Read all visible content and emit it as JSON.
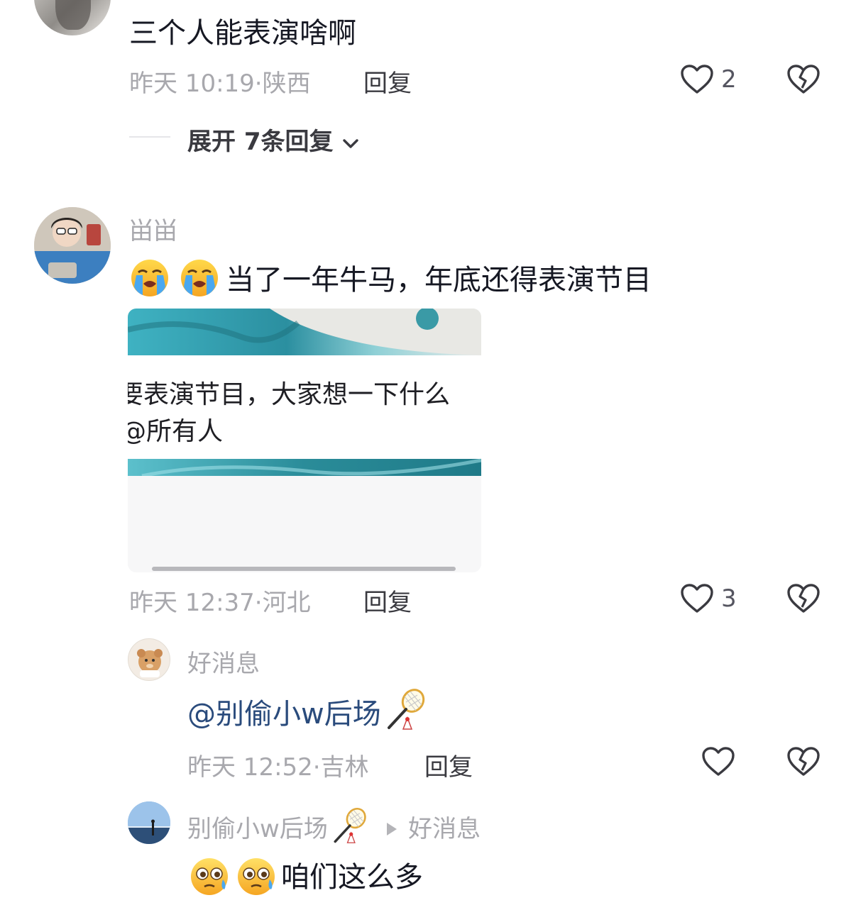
{
  "comments": [
    {
      "text": "三个人能表演啥啊",
      "time": "昨天 10:19",
      "location": "陕西",
      "reply_label": "回复",
      "likes": "2",
      "expand_label": "展开 7条回复"
    },
    {
      "username": "畄畄",
      "text": "当了一年牛马，年底还得表演节目",
      "image_text_line1": "要表演节目，大家想一下什么",
      "image_text_line2": "@所有人",
      "time": "昨天 12:37",
      "location": "河北",
      "reply_label": "回复",
      "likes": "3"
    }
  ],
  "replies": [
    {
      "username": "好消息",
      "mention": "@别偷小w后场",
      "time": "昨天 12:52",
      "location": "吉林",
      "reply_label": "回复"
    },
    {
      "username": "别偷小w后场",
      "reply_to": "好消息",
      "text": "咱们这么多"
    }
  ],
  "separator": "·",
  "colors": {
    "meta": "#a8a8ad",
    "mention": "#2a4b7c",
    "text": "#161823"
  }
}
